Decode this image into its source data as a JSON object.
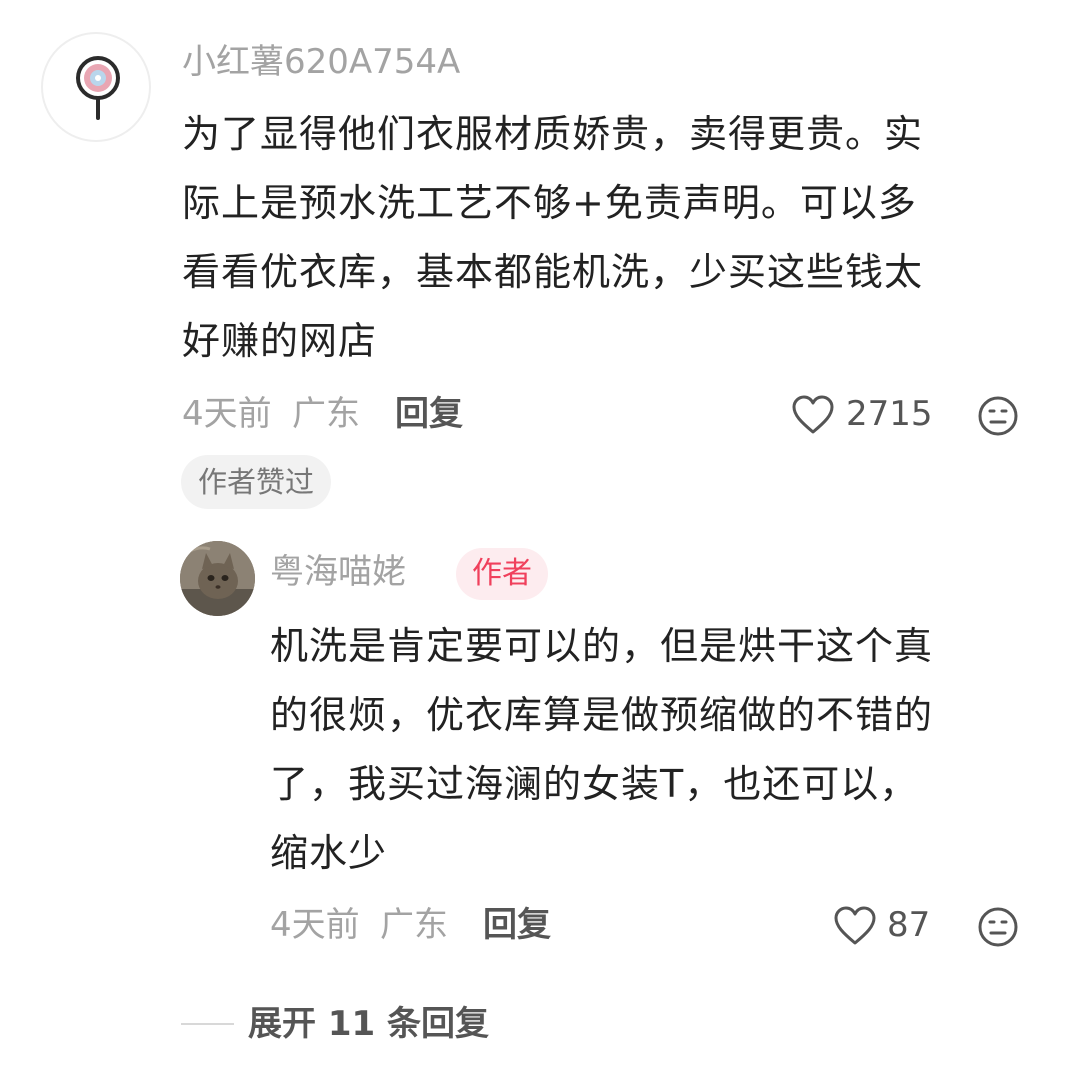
{
  "comment": {
    "username": "小红薯620A754A",
    "lines": [
      "为了显得他们衣服材质娇贵，卖得更贵。实",
      "际上是预水洗工艺不够+免责声明。可以多",
      "看看优衣库，基本都能机洗，少买这些钱太",
      "好赚的网店"
    ],
    "time": "4天前",
    "location": "广东",
    "reply_label": "回复",
    "likes": "2715",
    "author_liked_label": "作者赞过"
  },
  "reply": {
    "username": "粤海喵姥",
    "author_badge": "作者",
    "lines": [
      "机洗是肯定要可以的，但是烘干这个真",
      "的很烦，优衣库算是做预缩做的不错的",
      "了，我买过海澜的女装T，也还可以，",
      "缩水少"
    ],
    "time": "4天前",
    "location": "广东",
    "reply_label": "回复",
    "likes": "87"
  },
  "expand_replies": "展开 11 条回复",
  "colors": {
    "muted": "#a3a3a3",
    "text": "#222222",
    "badge_text": "#f0405c",
    "badge_bg": "#fdecef"
  }
}
